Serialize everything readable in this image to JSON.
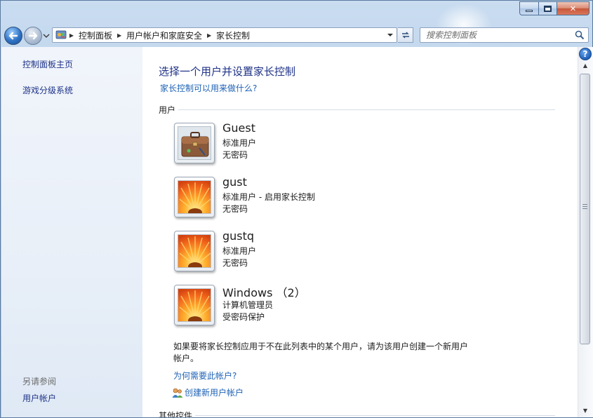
{
  "window": {
    "minimize_label": "",
    "maximize_label": "",
    "close_label": "✕"
  },
  "nav": {
    "breadcrumbs": [
      "控制面板",
      "用户帐户和家庭安全",
      "家长控制"
    ],
    "search_placeholder": "搜索控制面板"
  },
  "sidebar": {
    "links": [
      "控制面板主页",
      "游戏分级系统"
    ],
    "see_also_heading": "另请参阅",
    "see_also_links": [
      "用户帐户"
    ]
  },
  "main": {
    "title": "选择一个用户并设置家长控制",
    "help_link": "家长控制可以用来做什么?",
    "users_section": "用户",
    "users": [
      {
        "name": "Guest",
        "type": "标准用户",
        "password": "无密码",
        "avatar": "briefcase-icon"
      },
      {
        "name": "gust",
        "type": "标准用户 - 启用家长控制",
        "password": "无密码",
        "avatar": "flower-icon"
      },
      {
        "name": "gustq",
        "type": "标准用户",
        "password": "无密码",
        "avatar": "flower-icon"
      },
      {
        "name": "Windows （2）",
        "type": "计算机管理员",
        "password": "受密码保护",
        "avatar": "flower-icon"
      }
    ],
    "note": "如果要将家长控制应用于不在此列表中的某个用户，请为该用户创建一个新用户帐户。",
    "why_link": "为何需要此帐户?",
    "create_link": "创建新用户帐户",
    "other_section": "其他控件"
  },
  "colors": {
    "link": "#1e62b5",
    "title": "#1e3287",
    "sidebar_bg": "#eaf0f8"
  }
}
